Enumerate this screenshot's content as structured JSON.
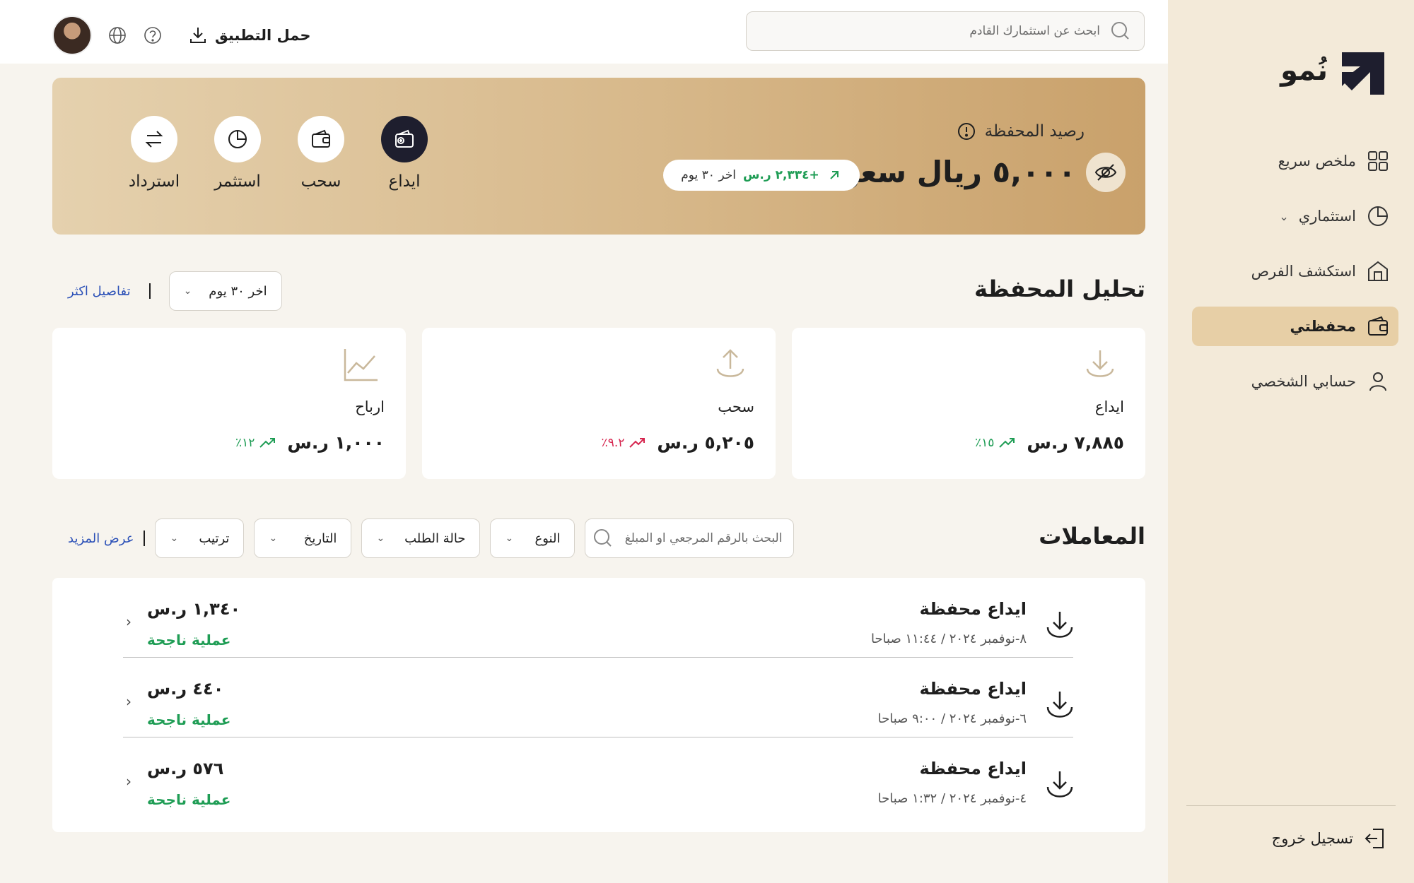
{
  "brand": {
    "name": "نُمو"
  },
  "sidebar": {
    "items": [
      {
        "label": "ملخص سريع",
        "icon": "grid-icon"
      },
      {
        "label": "استثماري",
        "icon": "pie-chart-icon"
      },
      {
        "label": "استكشف الفرص",
        "icon": "building-icon"
      },
      {
        "label": "محفظتي",
        "icon": "wallet-icon"
      },
      {
        "label": "حسابي الشخصي",
        "icon": "user-icon"
      }
    ],
    "logout": "تسجيل خروج"
  },
  "topbar": {
    "search_placeholder": "ابحث عن استثمارك القادم",
    "download_app": "حمل التطبيق"
  },
  "banner": {
    "label": "رصيد المحفظة",
    "balance": "٥,٠٠٠ ريال سعودي",
    "change": "+٢,٣٣٤ ر.س",
    "period": "اخر ٣٠ يوم",
    "actions": {
      "deposit": "ايداع",
      "withdraw": "سحب",
      "invest": "استثمر",
      "refund": "استرداد"
    }
  },
  "analysis": {
    "title": "تحليل المحفظة",
    "period_select": "اخر ٣٠ يوم",
    "details_link": "تفاصيل اكثر",
    "cards": {
      "deposit": {
        "label": "ايداع",
        "amount": "٧,٨٨٥ ر.س",
        "pct": "١٥٪"
      },
      "withdraw": {
        "label": "سحب",
        "amount": "٥,٢٠٥ ر.س",
        "pct": "٩.٢٪"
      },
      "profit": {
        "label": "ارباح",
        "amount": "١,٠٠٠ ر.س",
        "pct": "١٢٪"
      }
    }
  },
  "transactions": {
    "title": "المعاملات",
    "search_placeholder": "البحث بالرقم المرجعي او المبلغ",
    "filters": {
      "type": "النوع",
      "status": "حالة الطلب",
      "date": "التاريخ",
      "sort": "ترتيب"
    },
    "more_link": "عرض المزيد",
    "rows": [
      {
        "title": "ايداع محفظة",
        "date": "٨-نوفمبر ٢٠٢٤ / ١١:٤٤ صباحا",
        "amount": "١,٣٤٠ ر.س",
        "status": "عملية ناجحة"
      },
      {
        "title": "ايداع محفظة",
        "date": "٦-نوفمبر ٢٠٢٤ / ٩:٠٠ صباحا",
        "amount": "٤٤٠ ر.س",
        "status": "عملية ناجحة"
      },
      {
        "title": "ايداع محفظة",
        "date": "٤-نوفمبر ٢٠٢٤ / ١:٣٢ صباحا",
        "amount": "٥٧٦ ر.س",
        "status": "عملية ناجحة"
      }
    ]
  },
  "colors": {
    "accent": "#e7cfa6",
    "success": "#1f9d55",
    "danger": "#d6264f",
    "link": "#2b50b7"
  }
}
